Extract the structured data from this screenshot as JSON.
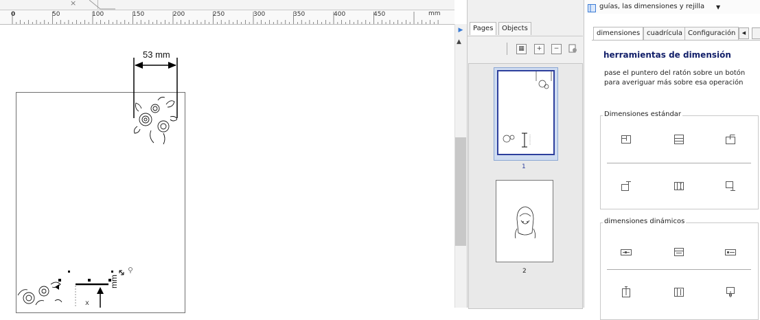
{
  "document_tab": {
    "close_glyph": "×"
  },
  "ruler": {
    "labels": [
      "0",
      "50",
      "100",
      "150",
      "200",
      "250",
      "300",
      "350",
      "400",
      "450"
    ],
    "unit": "mm"
  },
  "canvas": {
    "dimension_label": "53 mm",
    "vertical_dimension_label": "mm"
  },
  "pages_panel": {
    "tabs": [
      "Pages",
      "Objects"
    ],
    "toolbar_icons": [
      "thumbnail-view-icon",
      "add-page-icon",
      "remove-page-icon",
      "page-settings-icon"
    ],
    "pages": [
      {
        "number": "1",
        "selected": true
      },
      {
        "number": "2",
        "selected": false
      }
    ]
  },
  "docker": {
    "title": "guías, las dimensiones y rejilla",
    "tabs": [
      "dimensiones",
      "cuadrícula",
      "Configuración"
    ],
    "heading": "herramientas de dimensión",
    "description_line1": "pase el puntero del ratón sobre un botón",
    "description_line2": "para averiguar más sobre esa operación",
    "groups": [
      {
        "label": "Dimensiones estándar",
        "buttons": [
          "horizontal-dimension-icon",
          "vertical-center-dimension-icon",
          "top-dimension-icon",
          "bottom-left-dimension-icon",
          "vertical-dimension-icon",
          "right-dimension-icon"
        ]
      },
      {
        "label": "dimensiones dinámicos",
        "buttons": [
          "dynamic-horizontal-icon",
          "dynamic-center-icon",
          "dynamic-right-icon",
          "dynamic-vertical-icon",
          "dynamic-vertical-center-icon",
          "dynamic-bottom-icon"
        ]
      }
    ]
  },
  "colors": {
    "accent": "#2c3e9c",
    "heading": "#13206a",
    "selection": "#8aa6d3"
  }
}
